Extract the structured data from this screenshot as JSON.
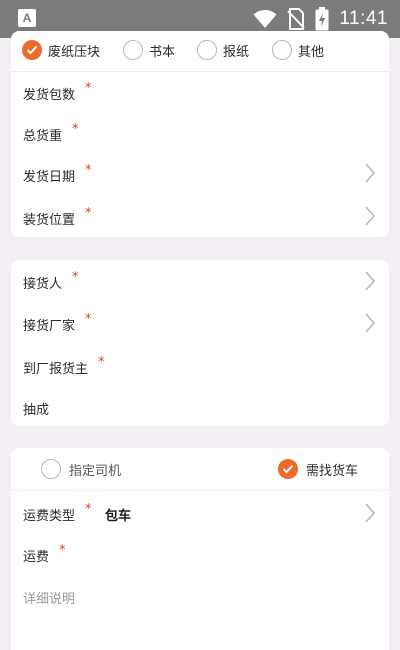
{
  "status_bar": {
    "app_icon_letter": "A",
    "time": "11:41",
    "icons": [
      "wifi-icon",
      "no-sim-icon",
      "battery-charging-icon"
    ]
  },
  "cargo_type": {
    "options": [
      {
        "label": "废纸压块",
        "checked": true
      },
      {
        "label": "书本",
        "checked": false
      },
      {
        "label": "报纸",
        "checked": false
      },
      {
        "label": "其他",
        "checked": false
      }
    ]
  },
  "shipment": {
    "packages_label": "发货包数",
    "total_weight_label": "总货重",
    "ship_date_label": "发货日期",
    "loading_location_label": "装货位置"
  },
  "receiver": {
    "receiver_label": "接货人",
    "receiving_factory_label": "接货厂家",
    "report_to_owner_label": "到厂报货主",
    "commission_label": "抽成"
  },
  "driver": {
    "assign_driver_label": "指定司机",
    "assign_driver_checked": false,
    "find_truck_label": "需找货车",
    "find_truck_checked": true,
    "freight_type_label": "运费类型",
    "freight_type_value": "包车",
    "freight_label": "运费",
    "details_placeholder": "详细说明"
  },
  "colors": {
    "accent": "#ec6b2a",
    "required_star": "#d6452a",
    "background": "#f3eff4",
    "status_bar": "#7b7b7b"
  }
}
